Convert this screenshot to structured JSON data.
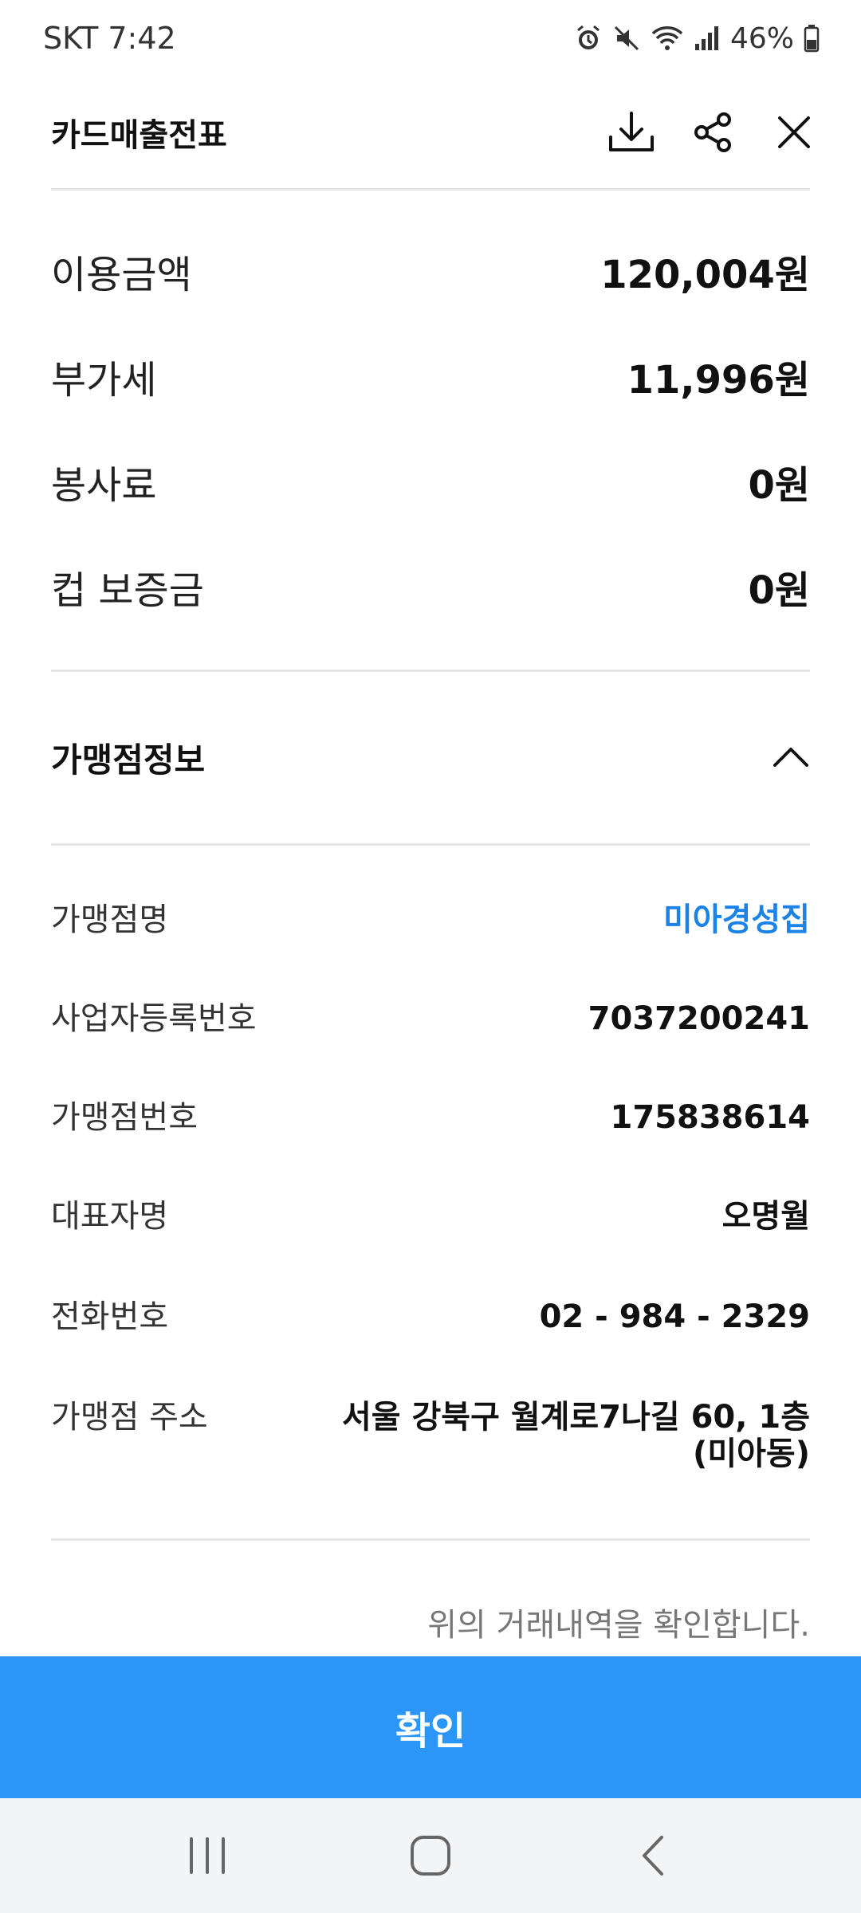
{
  "status_bar": {
    "carrier_time": "SKT 7:42",
    "battery": "46%"
  },
  "header": {
    "title": "카드매출전표"
  },
  "amounts": [
    {
      "label": "이용금액",
      "value": "120,004원"
    },
    {
      "label": "부가세",
      "value": "11,996원"
    },
    {
      "label": "봉사료",
      "value": "0원"
    },
    {
      "label": "컵 보증금",
      "value": "0원"
    }
  ],
  "merchant_section": {
    "title": "가맹점정보",
    "rows": [
      {
        "label": "가맹점명",
        "value": "미아경성집"
      },
      {
        "label": "사업자등록번호",
        "value": "7037200241"
      },
      {
        "label": "가맹점번호",
        "value": "175838614"
      },
      {
        "label": "대표자명",
        "value": "오명월"
      },
      {
        "label": "전화번호",
        "value": "02 - 984 - 2329"
      },
      {
        "label": "가맹점 주소",
        "value": "서울 강북구 월계로7나길 60, 1층 (미아동)"
      }
    ]
  },
  "confirm_text": "위의 거래내역을 확인합니다.",
  "confirm_button_label": "확인",
  "colors": {
    "accent": "#2b95f8",
    "link": "#1b82e8"
  }
}
